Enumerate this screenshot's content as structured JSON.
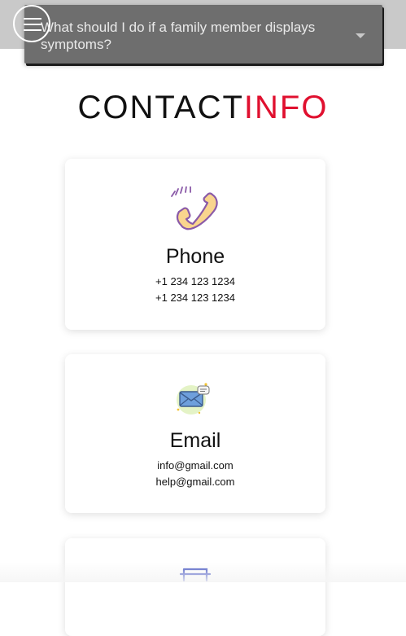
{
  "faq": {
    "selected_question": "What should I do if a family member displays symptoms?",
    "caret_icon": "chevron-down-icon"
  },
  "menu": {
    "icon": "hamburger-menu-icon"
  },
  "contact": {
    "title_part1": "CONTACT",
    "title_part2": "INFO",
    "accent_color": "#e0102f",
    "cards": [
      {
        "title": "Phone",
        "icon": "phone-icon",
        "lines": [
          "+1 234 123 1234",
          "+1 234 123 1234"
        ]
      },
      {
        "title": "Email",
        "icon": "email-icon",
        "lines": [
          "info@gmail.com",
          "help@gmail.com"
        ]
      },
      {
        "icon": "location-icon"
      }
    ]
  }
}
